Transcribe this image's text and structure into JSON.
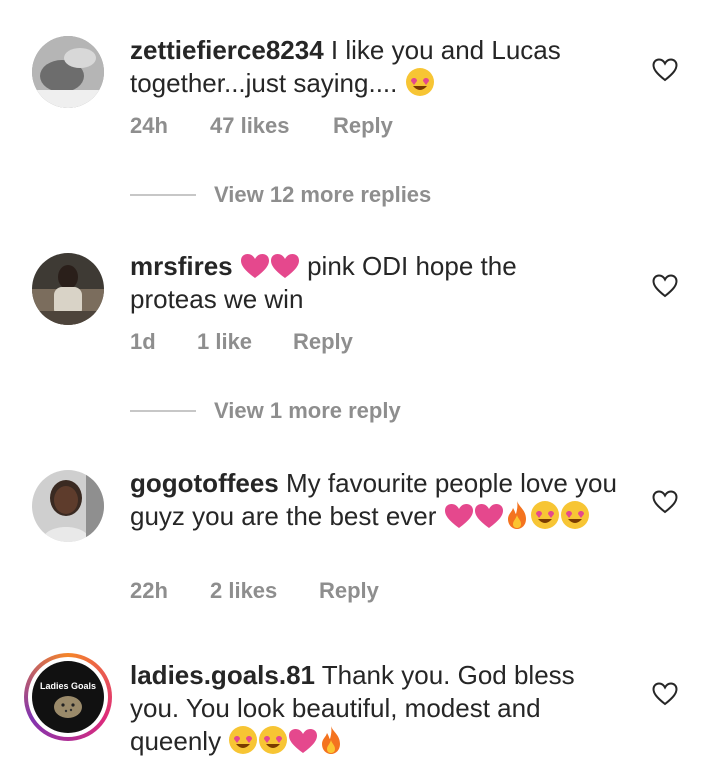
{
  "comments": [
    {
      "username": "zettiefierce8234",
      "text": "I like you and Lucas together...just saying....",
      "time": "24h",
      "likes": "47 likes",
      "reply": "Reply",
      "view_replies": "View 12 more replies"
    },
    {
      "username": "mrsfires",
      "text_a": "pink ODI hope the",
      "text_b": "proteas we win",
      "time": "1d",
      "likes": "1 like",
      "reply": "Reply",
      "view_replies": "View 1 more reply"
    },
    {
      "username": "gogotoffees",
      "text": "My favourite people love you guyz you are the best ever",
      "time": "22h",
      "likes": "2 likes",
      "reply": "Reply"
    },
    {
      "username": "ladies.goals.81",
      "text": "Thank you. God bless you. You look beautiful, modest and queenly",
      "avatar_text": "Ladies Goals"
    }
  ],
  "colors": {
    "heart_emoji": "#e5488d",
    "face_emoji": "#f7c534",
    "meta_text": "#8e8e8e",
    "divider": "#c7c7c7"
  },
  "icons": [
    "heart-outline-icon",
    "heart-eyes-emoji",
    "pink-heart-emoji",
    "fire-emoji"
  ]
}
